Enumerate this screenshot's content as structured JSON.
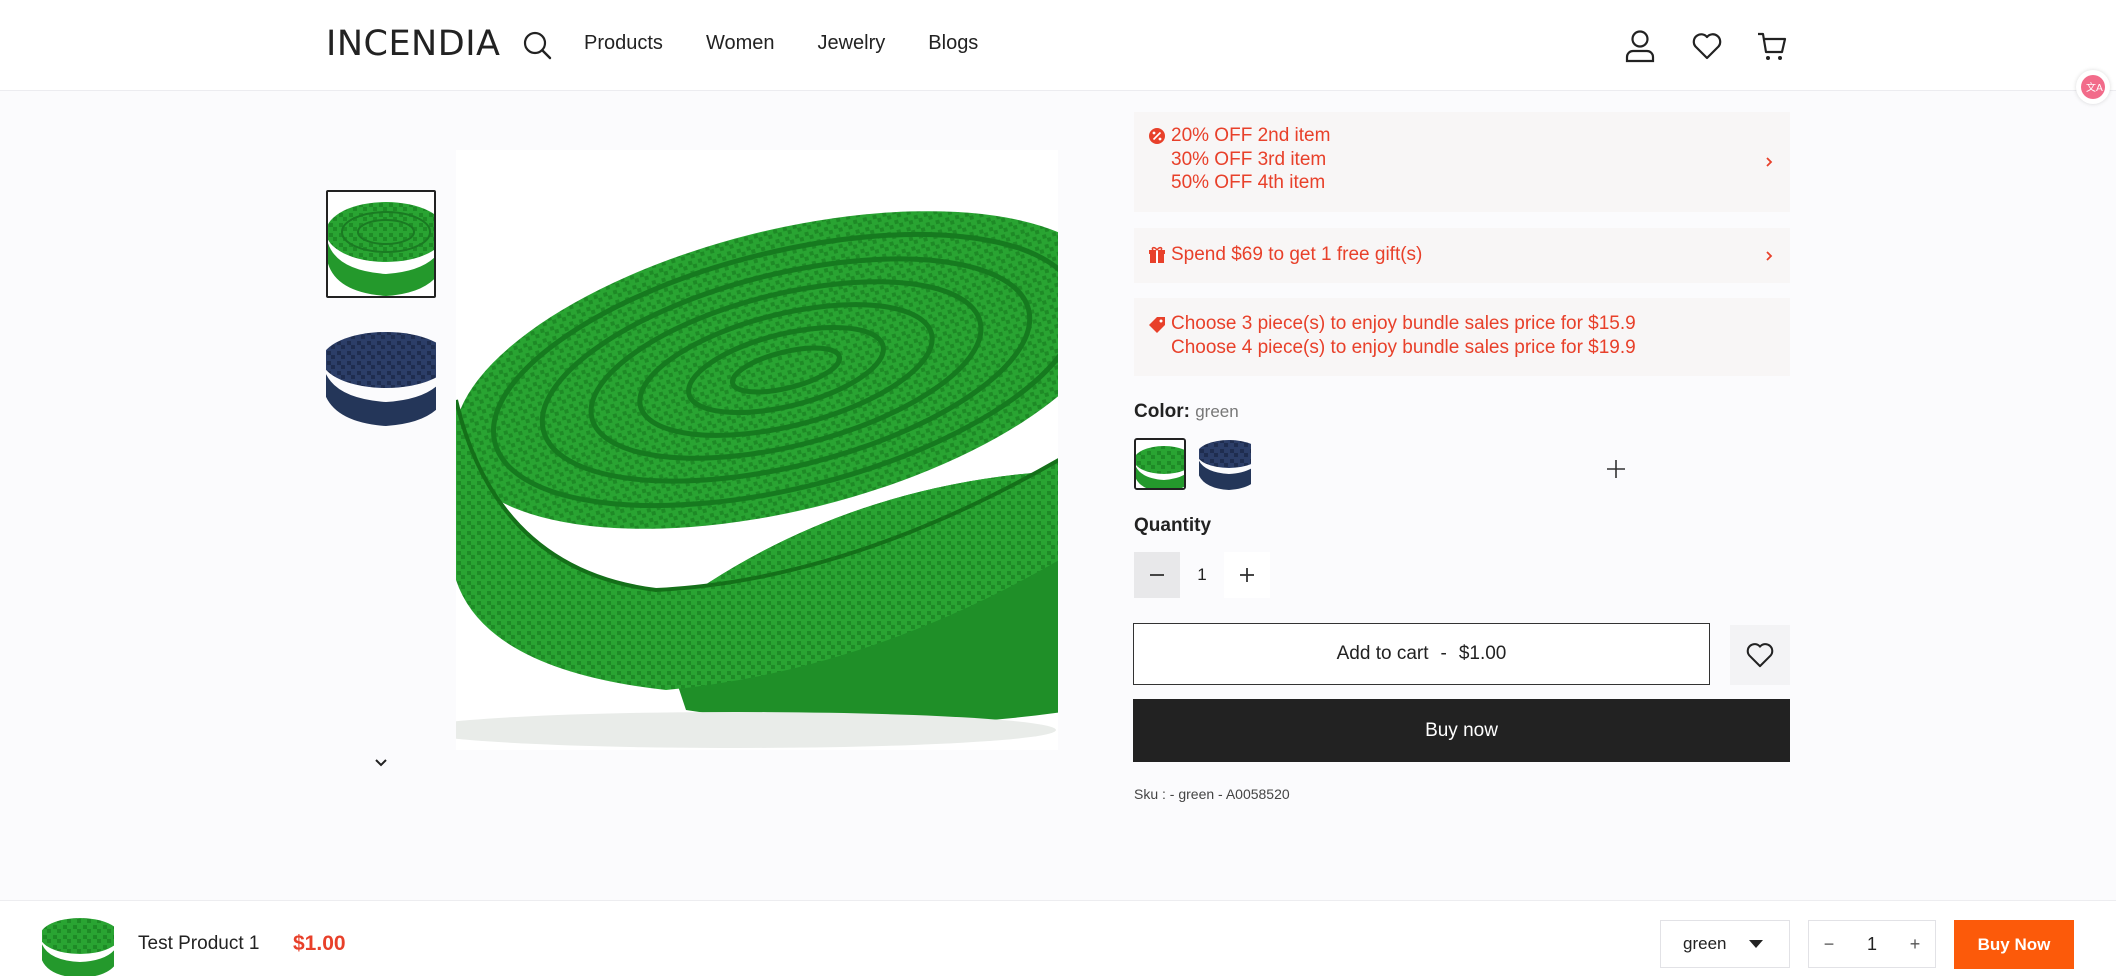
{
  "header": {
    "logo": "INCENDIA",
    "nav": [
      "Products",
      "Women",
      "Jewelry",
      "Blogs"
    ]
  },
  "promotions": {
    "tiered_discount": [
      "20% OFF 2nd item",
      "30% OFF 3rd item",
      "50% OFF 4th item"
    ],
    "gift": "Spend $69 to get 1 free gift(s)",
    "bundle": [
      "Choose 3 piece(s) to enjoy bundle sales price for $15.9",
      "Choose 4 piece(s) to enjoy bundle sales price for $19.9"
    ]
  },
  "product": {
    "color_label": "Color:",
    "color_value": "green",
    "quantity_label": "Quantity",
    "quantity": "1",
    "add_to_cart": "Add to cart",
    "add_to_cart_sep": "-",
    "price": "$1.00",
    "buy_now": "Buy now",
    "sku": "Sku : - green - A0058520"
  },
  "sticky_bar": {
    "name": "Test Product 1",
    "price": "$1.00",
    "variant": "green",
    "quantity": "1",
    "minus": "−",
    "plus": "+",
    "buy_now": "Buy Now"
  },
  "colors": {
    "accent_red": "#e8402a",
    "buy_orange": "#fc5a0a",
    "dark": "#222222",
    "swatch_green": "#2faa35",
    "swatch_navy": "#2a3b63"
  }
}
